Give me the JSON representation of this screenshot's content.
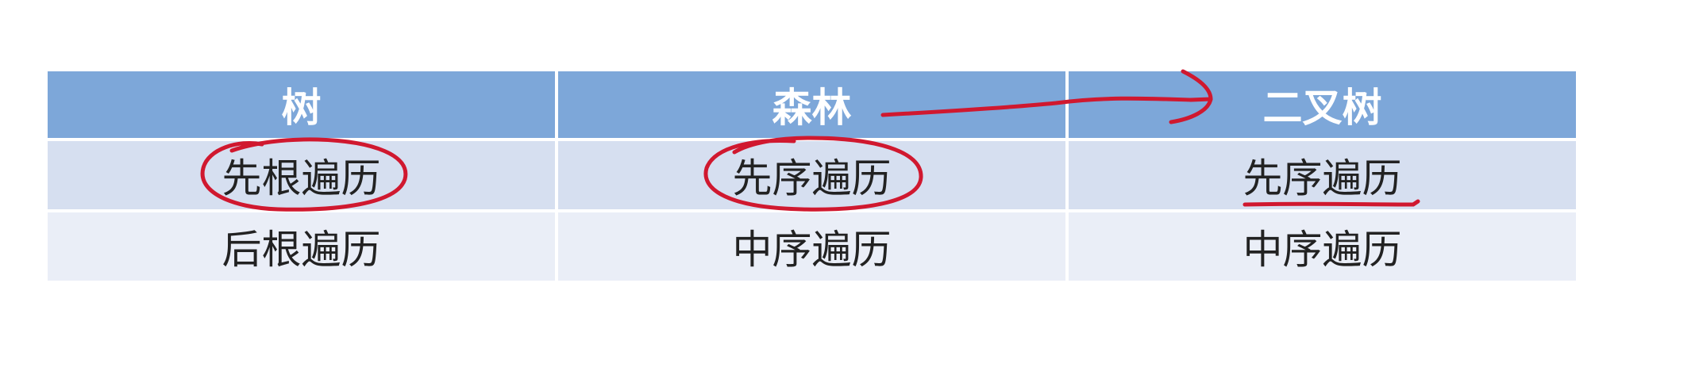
{
  "table": {
    "headers": [
      "树",
      "森林",
      "二叉树"
    ],
    "rows": [
      [
        "先根遍历",
        "先序遍历",
        "先序遍历"
      ],
      [
        "后根遍历",
        "中序遍历",
        "中序遍历"
      ]
    ]
  },
  "annotations": {
    "ink_color": "#d0182f"
  }
}
